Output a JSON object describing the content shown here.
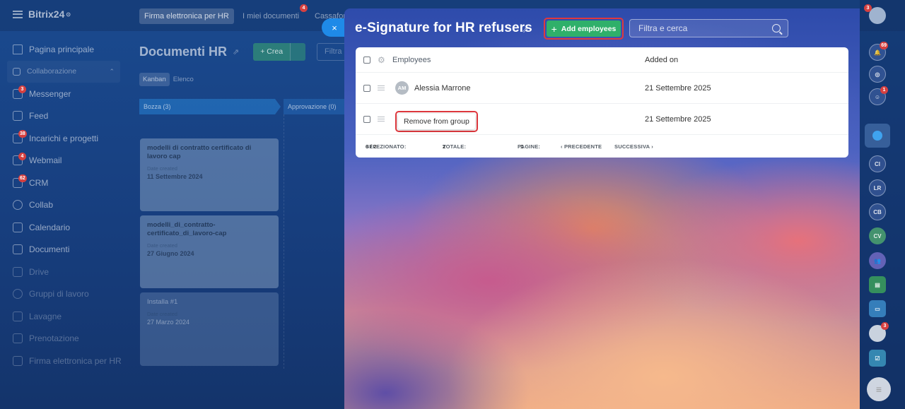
{
  "app": {
    "brand": "Bitrix24",
    "top_tabs": [
      {
        "label": "Firma elettronica per HR",
        "active": true
      },
      {
        "label": "I miei documenti",
        "badge": "4"
      },
      {
        "label": "Cassafor"
      }
    ]
  },
  "sidebar": {
    "items": [
      {
        "label": "Pagina principale"
      },
      {
        "label": "Collaborazione",
        "section": true
      },
      {
        "label": "Messenger",
        "badge": "3"
      },
      {
        "label": "Feed"
      },
      {
        "label": "Incarichi e progetti",
        "badge": "38"
      },
      {
        "label": "Webmail",
        "badge": "4"
      },
      {
        "label": "CRM",
        "badge": "62"
      },
      {
        "label": "Collab"
      },
      {
        "label": "Calendario"
      },
      {
        "label": "Documenti"
      },
      {
        "label": "Drive"
      },
      {
        "label": "Gruppi di lavoro"
      },
      {
        "label": "Lavagne"
      },
      {
        "label": "Prenotazione"
      },
      {
        "label": "Firma elettronica per HR"
      }
    ]
  },
  "page": {
    "title": "Documenti HR",
    "create_label": "+ Crea",
    "filter_placeholder": "Filtra e",
    "views": [
      "Kanban",
      "Elenco"
    ],
    "columns": [
      {
        "label": "Bozza (3)"
      },
      {
        "label": "Approvazione (0)"
      }
    ],
    "cards": [
      {
        "title": "modelli di contratto certificato di lavoro cap",
        "date_label": "Date created",
        "date": "11 Settembre 2024"
      },
      {
        "title": "modelli_di_contratto-certificato_di_lavoro-cap",
        "date_label": "Date created",
        "date": "27 Giugno 2024"
      },
      {
        "title": "Installa #1",
        "date_label": "Date created",
        "date": "27 Marzo 2024"
      }
    ]
  },
  "rightbar": {
    "notifications_badge": "69",
    "chat_badge": "1",
    "avatar_badge": "3",
    "avatars": [
      "CI",
      "LR",
      "CB",
      "CV"
    ]
  },
  "slider": {
    "close_icon": "×",
    "title": "e-Signature for HR refusers",
    "add_button": "Add employees",
    "search_placeholder": "Filtra e cerca",
    "grid": {
      "headers": {
        "employees": "Employees",
        "added_on": "Added on"
      },
      "rows": [
        {
          "initials": "AM",
          "name": "Alessia Marrone",
          "added_on": "21 Settembre 2025"
        },
        {
          "popup": "Remove from group",
          "added_on": "21 Settembre 2025"
        }
      ],
      "footer": {
        "selected_label": "SELEZIONATO:",
        "selected_value": "0 / 2",
        "total_label": "TOTALE:",
        "total_value": "2",
        "pages_label": "PAGINE:",
        "pages_value": "1",
        "prev": "‹ PRECEDENTE",
        "next": "SUCCESSIVA ›"
      }
    }
  }
}
